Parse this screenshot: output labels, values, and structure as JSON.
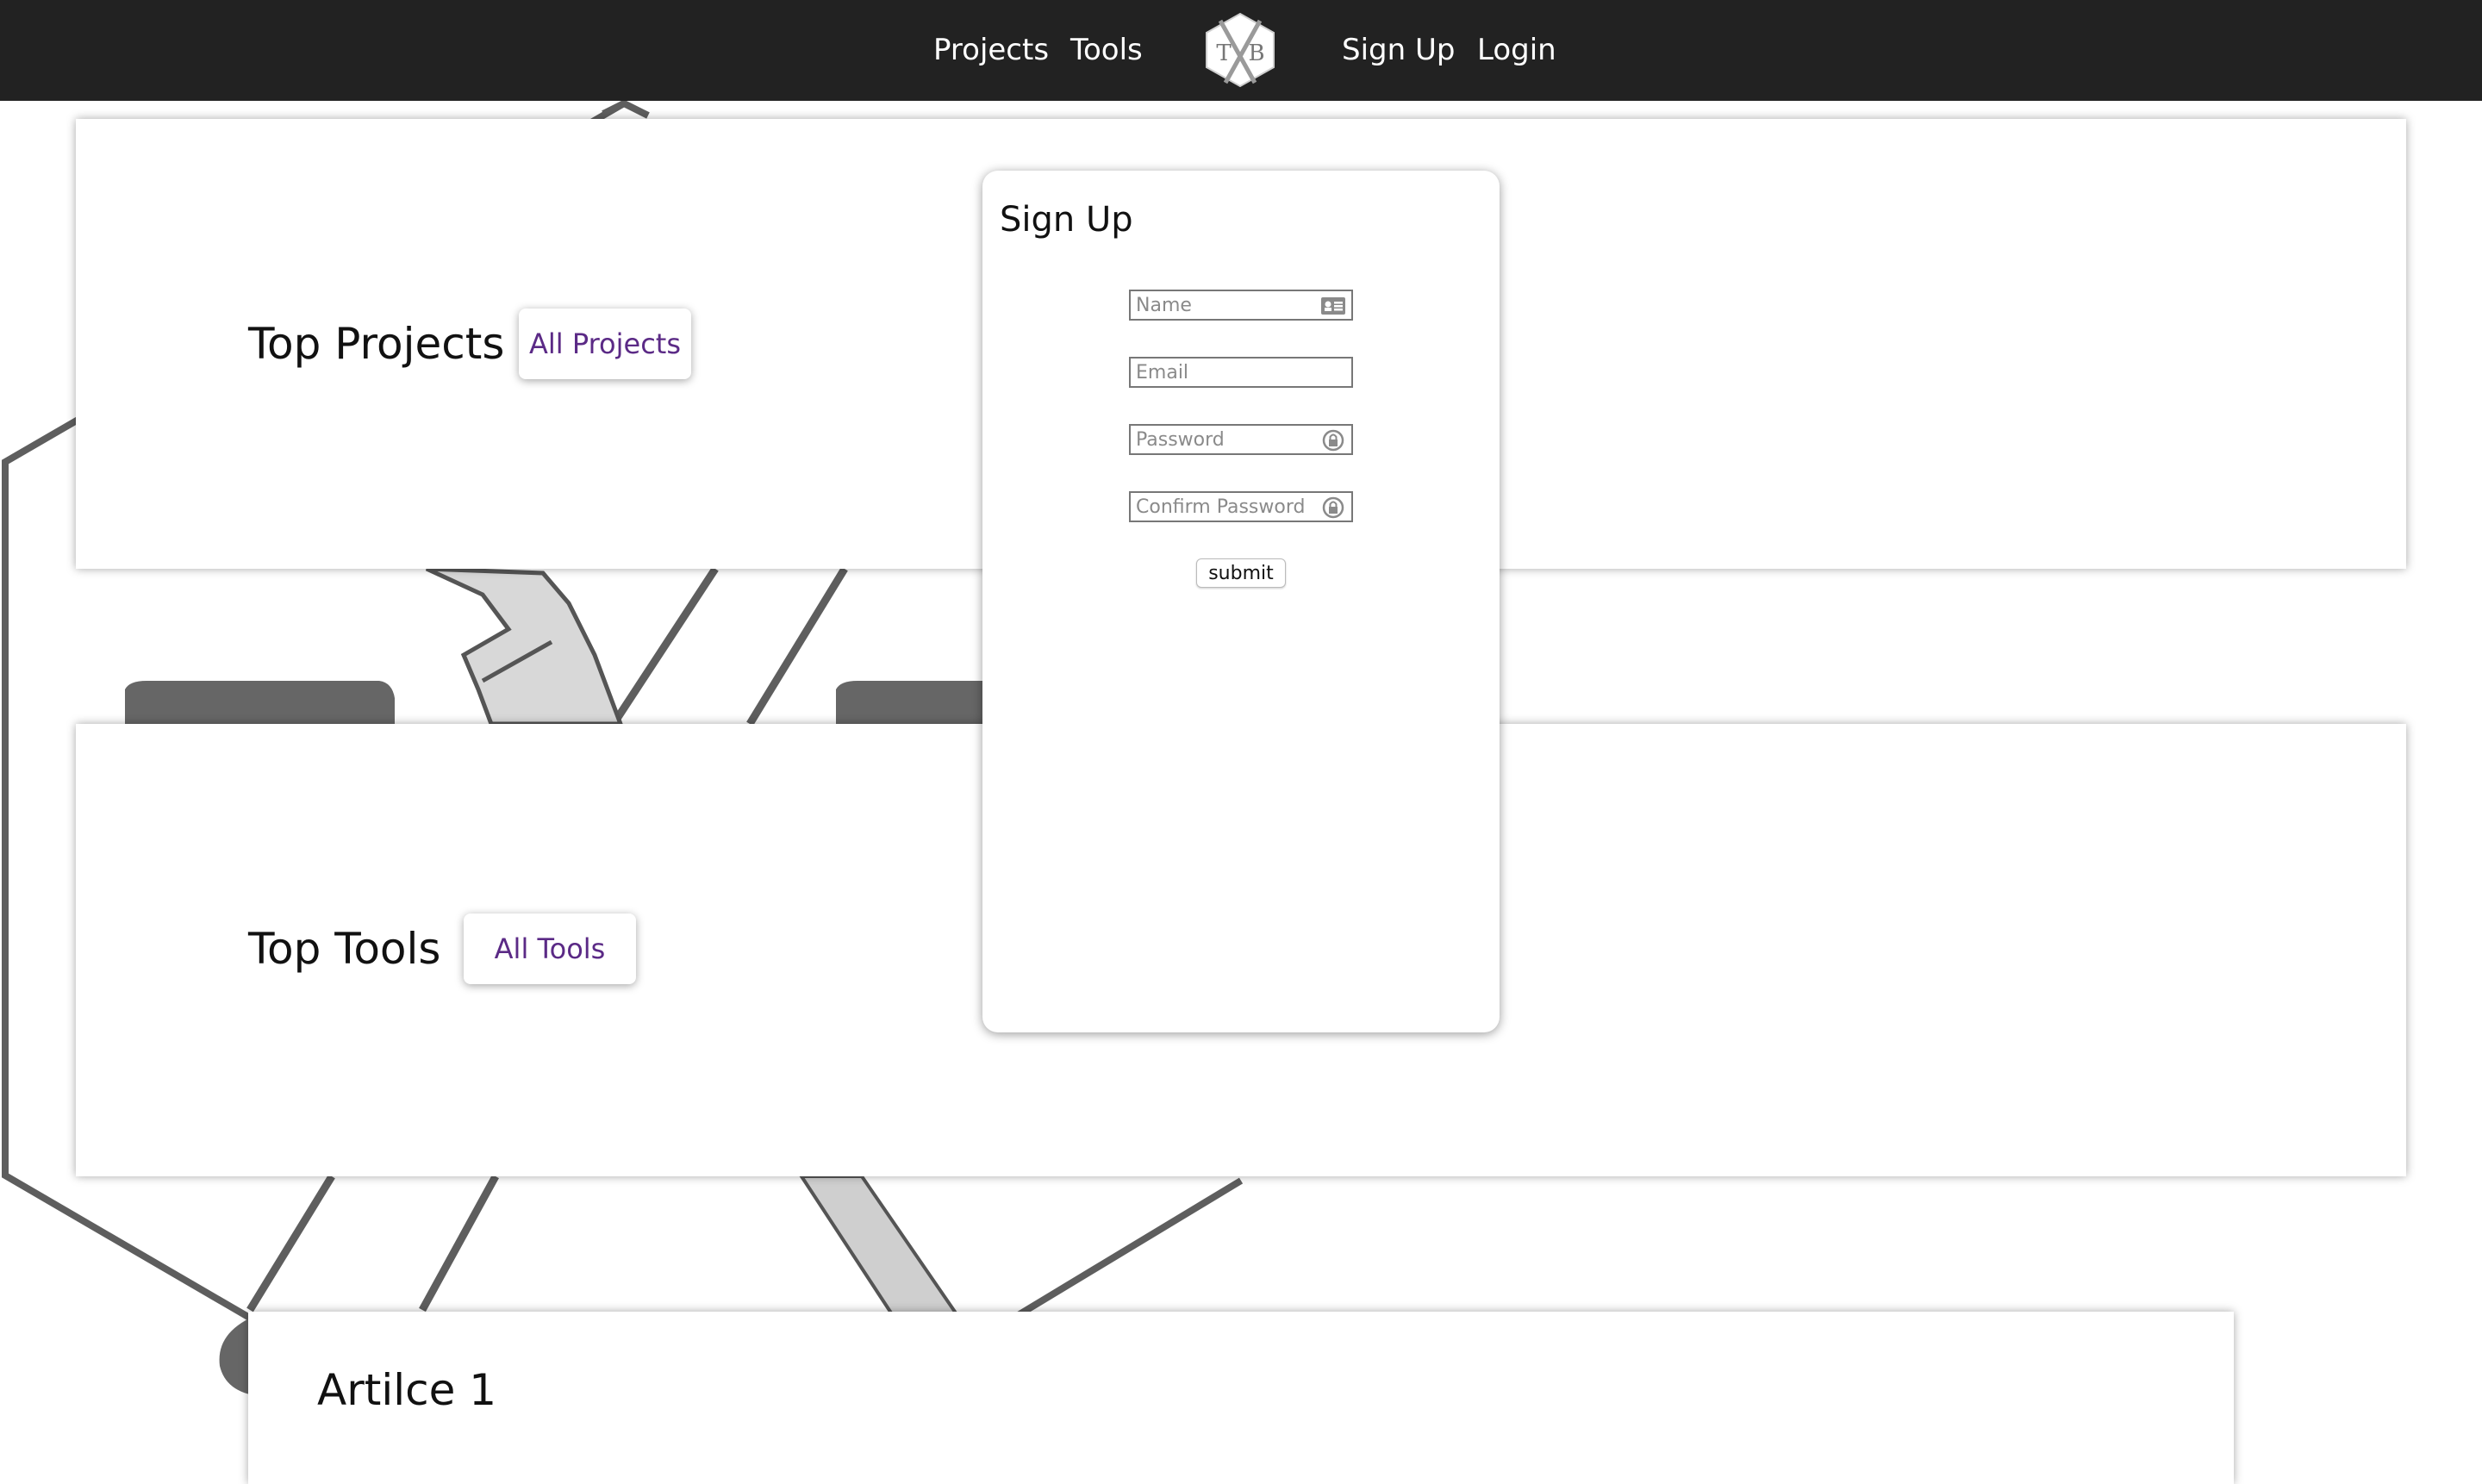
{
  "nav": {
    "projects": "Projects",
    "tools": "Tools",
    "logo_left_letter": "T",
    "logo_right_letter": "B",
    "signup": "Sign Up",
    "login": "Login"
  },
  "sections": {
    "projects": {
      "title": "Top Projects",
      "button": "All Projects"
    },
    "tools": {
      "title": "Top Tools",
      "button": "All Tools"
    },
    "article": {
      "title": "Artilce 1"
    }
  },
  "signup_modal": {
    "title": "Sign Up",
    "name_placeholder": "Name",
    "email_placeholder": "Email",
    "password_placeholder": "Password",
    "confirm_password_placeholder": "Confirm Password",
    "submit_label": "submit"
  },
  "colors": {
    "navbar": "#222222",
    "accent": "#5b2a86",
    "background_art": "#666666"
  },
  "icons": {
    "name_field": "id-card-icon",
    "password_field": "lock-icon",
    "confirm_password_field": "lock-icon"
  }
}
